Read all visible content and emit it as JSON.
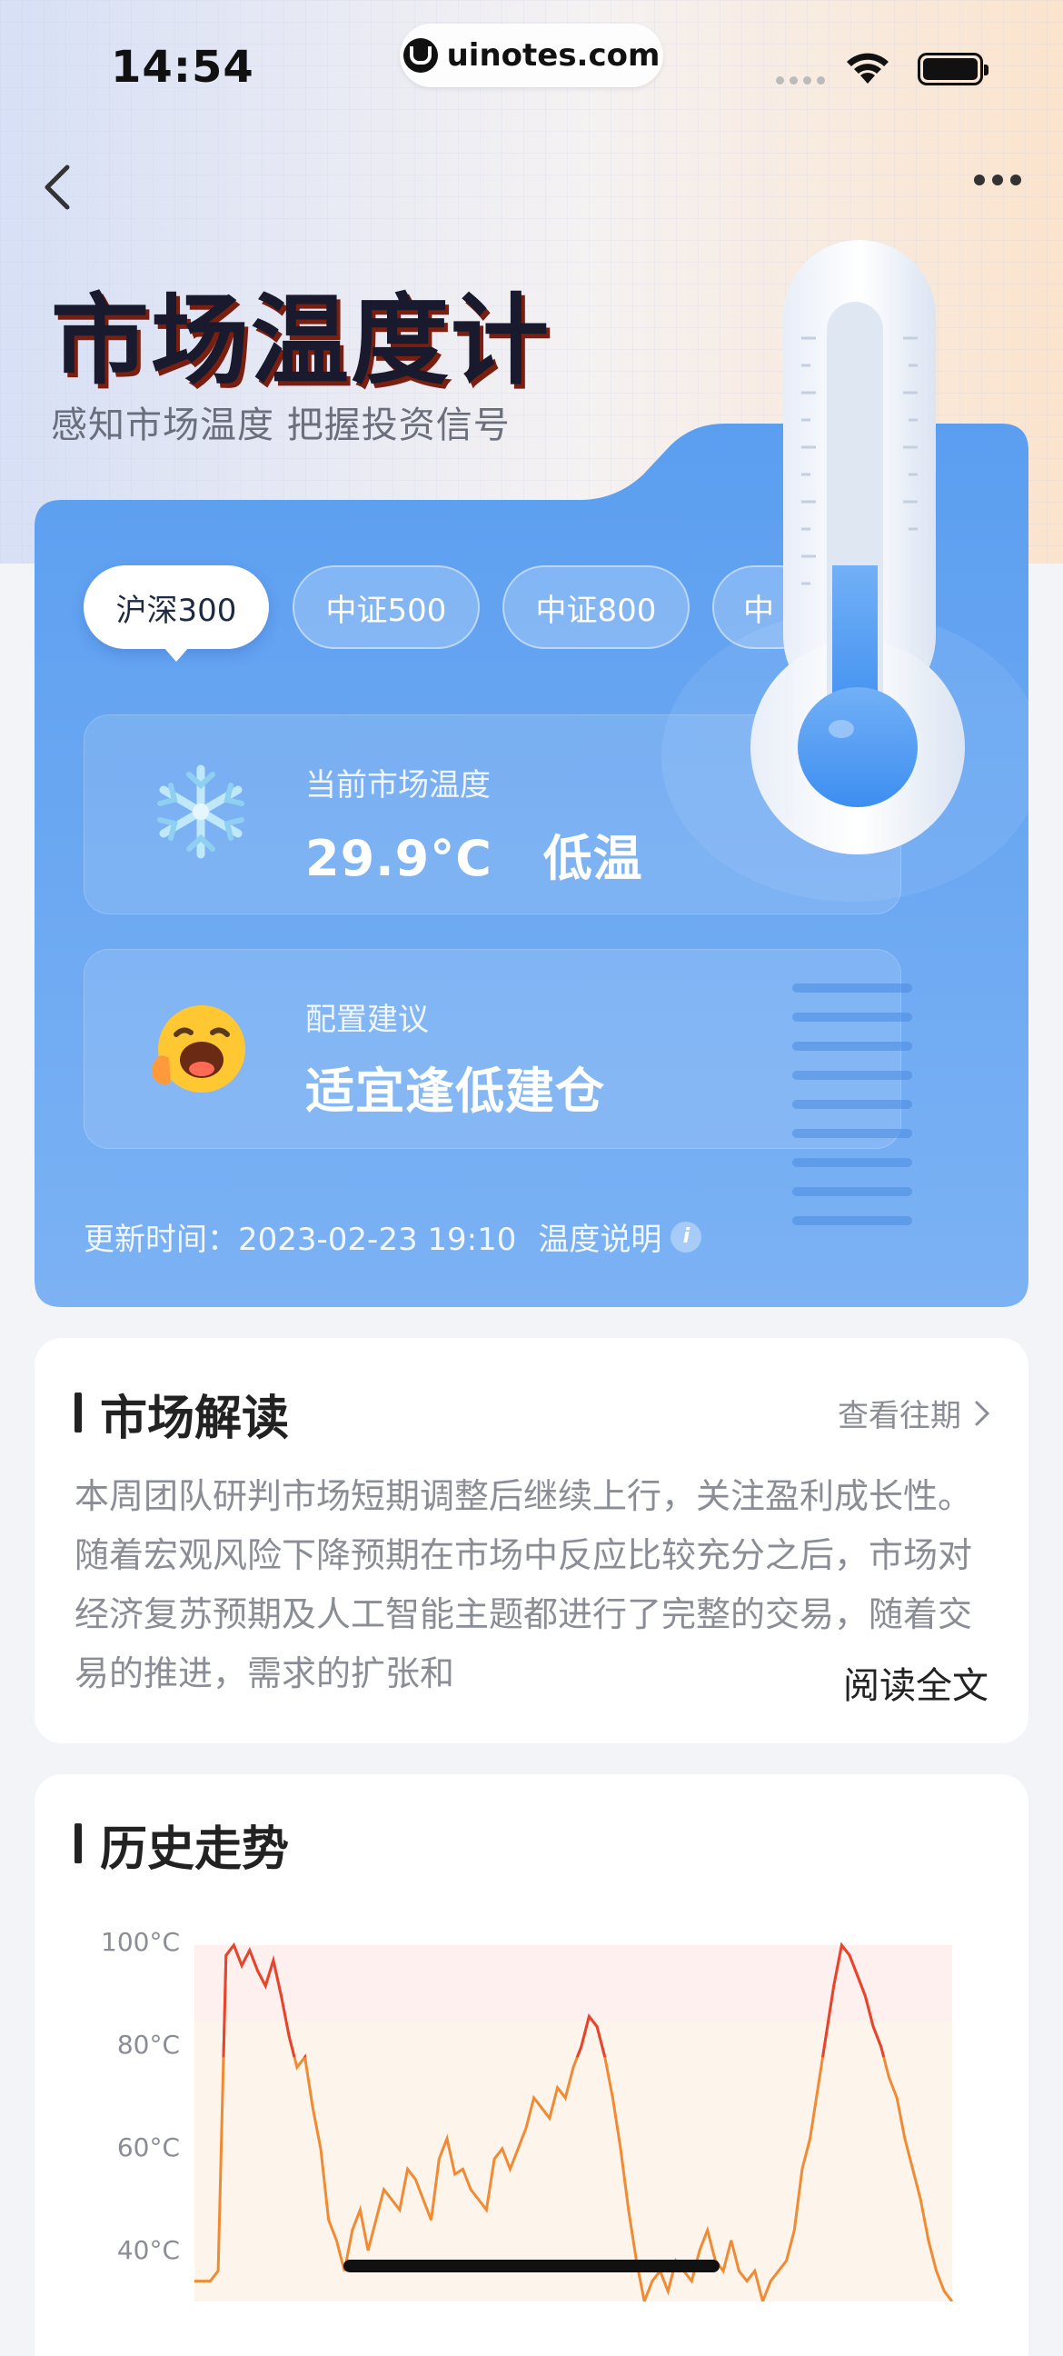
{
  "status_bar": {
    "time": "14:54",
    "url": "uinotes.com"
  },
  "header": {
    "title": "市场温度计",
    "subtitle": "感知市场温度 把握投资信号"
  },
  "index_tabs": [
    {
      "label": "沪深300",
      "active": true
    },
    {
      "label": "中证500",
      "active": false
    },
    {
      "label": "中证800",
      "active": false
    },
    {
      "label": "中",
      "active": false
    }
  ],
  "temperature": {
    "label": "当前市场温度",
    "value": "29.9°C",
    "level": "低温",
    "icon": "snowflake-icon"
  },
  "advice": {
    "label": "配置建议",
    "value": "适宜逢低建仓",
    "icon": "excited-face-icon"
  },
  "update": {
    "text": "更新时间：2023-02-23 19:10",
    "explain_label": "温度说明"
  },
  "interpretation": {
    "title": "市场解读",
    "see_past": "查看往期",
    "body": "本周团队研判市场短期调整后继续上行，关注盈利成长性。随着宏观风险下降预期在市场中反应比较充分之后，市场对经济复苏预期及人工智能主题都进行了完整的交易，随着交易的推进，需求的扩张和",
    "read_all": "阅读全文"
  },
  "history": {
    "title": "历史走势"
  },
  "chart_data": {
    "type": "line",
    "title": "历史走势",
    "ylabel": "",
    "yticks": [
      "100°C",
      "80°C",
      "60°C",
      "40°C"
    ],
    "ylim": [
      30,
      100
    ],
    "series": [
      {
        "values": [
          34,
          34,
          34,
          36,
          98,
          100,
          96,
          99,
          95,
          92,
          97,
          90,
          82,
          76,
          78,
          68,
          60,
          46,
          42,
          36,
          44,
          48,
          40,
          46,
          52,
          50,
          48,
          56,
          54,
          50,
          46,
          58,
          62,
          55,
          56,
          52,
          50,
          48,
          58,
          60,
          56,
          60,
          64,
          70,
          68,
          66,
          72,
          70,
          76,
          80,
          86,
          84,
          78,
          70,
          60,
          48,
          38,
          30,
          34,
          36,
          32,
          38,
          36,
          34,
          40,
          44,
          38,
          36,
          42,
          36,
          34,
          36,
          30,
          34,
          36,
          38,
          44,
          56,
          62,
          72,
          82,
          92,
          100,
          98,
          94,
          90,
          84,
          80,
          74,
          70,
          62,
          56,
          50,
          42,
          36,
          32,
          30
        ]
      }
    ],
    "colors": {
      "hot": "#e8432e",
      "warm": "#f08a33"
    }
  },
  "colors": {
    "card_blue": "#5b9cf0",
    "accent_dark": "#1a1a2e"
  }
}
